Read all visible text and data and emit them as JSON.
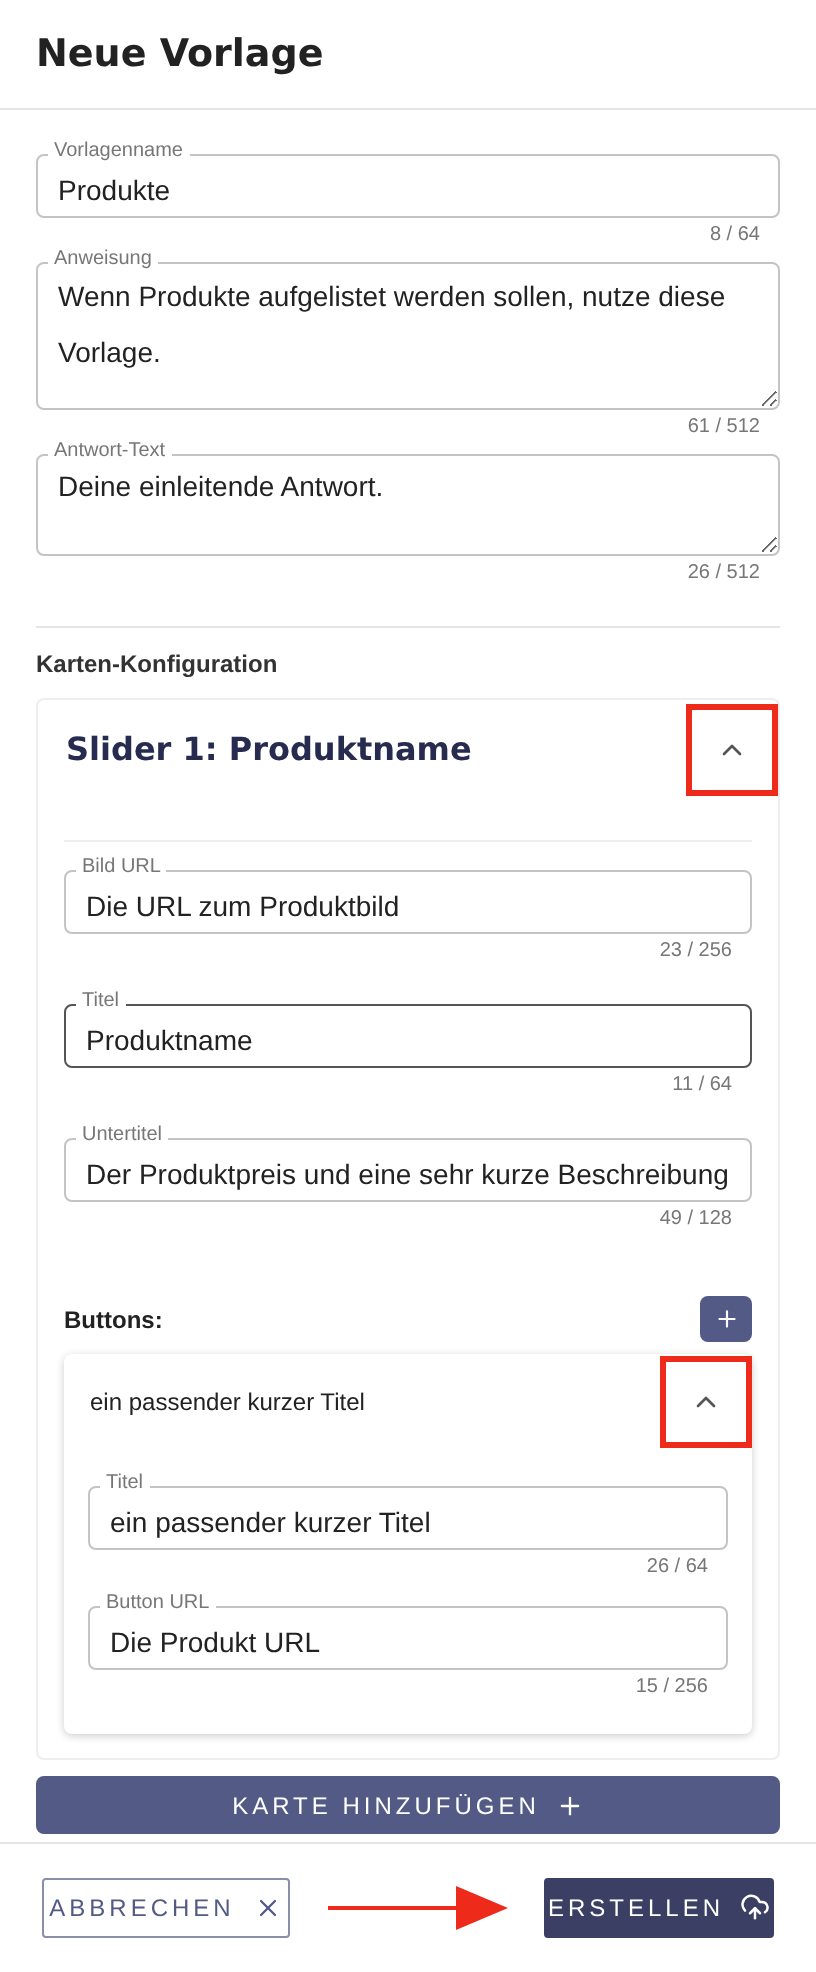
{
  "header": {
    "title": "Neue Vorlage"
  },
  "fields": [
    {
      "kind": "input",
      "label": "Vorlagenname",
      "value": "Produkte",
      "counter": "8 / 64",
      "focused": false
    },
    {
      "kind": "textarea",
      "label": "Anweisung",
      "value": "Wenn Produkte aufgelistet werden sollen, nutze diese Vorlage.",
      "counter": "61 / 512",
      "focused": false
    },
    {
      "kind": "textarea",
      "label": "Antwort-Text",
      "value": "Deine einleitende Antwort.",
      "counter": "26 / 512",
      "focused": false
    }
  ],
  "section_title": "Karten-Konfiguration",
  "cards": [
    {
      "title": "Slider 1: Produktname",
      "expanded": true,
      "highlighted": true,
      "fields": [
        {
          "kind": "input",
          "label": "Bild URL",
          "value": "Die URL zum Produktbild",
          "counter": "23 / 256",
          "focused": false
        },
        {
          "kind": "input",
          "label": "Titel",
          "value": "Produktname",
          "counter": "11 / 64",
          "focused": true
        },
        {
          "kind": "input",
          "label": "Untertitel",
          "value": "Der Produktpreis und eine sehr kurze Beschreibung",
          "counter": "49 / 128",
          "focused": false
        }
      ],
      "buttons_label": "Buttons:",
      "buttons": [
        {
          "title": "ein passender kurzer Titel",
          "expanded": true,
          "highlighted": true,
          "fields": [
            {
              "kind": "input",
              "label": "Titel",
              "value": "ein passender kurzer Titel",
              "counter": "26 / 64",
              "focused": false
            },
            {
              "kind": "input",
              "label": "Button URL",
              "value": "Die Produkt URL",
              "counter": "15 / 256",
              "focused": false
            }
          ]
        }
      ]
    }
  ],
  "add_card_button": "KARTE HINZUFÜGEN",
  "footer": {
    "cancel": "ABBRECHEN",
    "create": "ERSTELLEN",
    "arrow": true
  }
}
